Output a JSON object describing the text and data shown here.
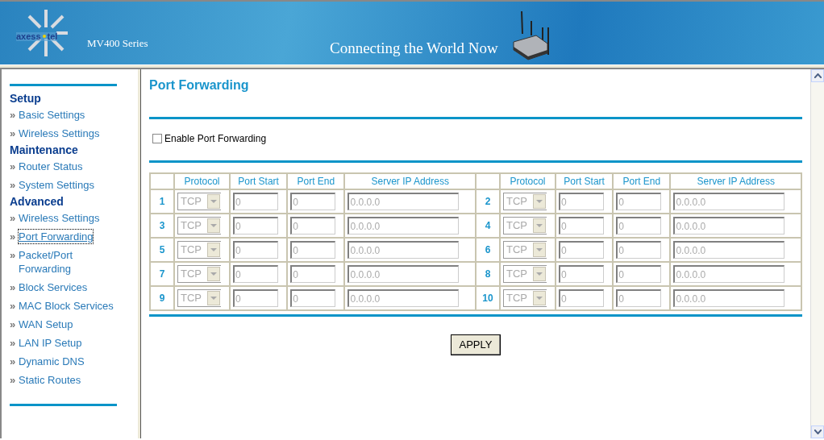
{
  "header": {
    "logo": {
      "left": "axess",
      "right": "tel"
    },
    "model": "MV400 Series",
    "slogan": "Connecting the World Now"
  },
  "sidebar": {
    "bullet": "»",
    "sections": [
      {
        "title": "Setup",
        "items": [
          {
            "label": "Basic Settings",
            "selected": false
          },
          {
            "label": "Wireless Settings",
            "selected": false
          }
        ]
      },
      {
        "title": "Maintenance",
        "items": [
          {
            "label": "Router Status",
            "selected": false
          },
          {
            "label": "System Settings",
            "selected": false
          }
        ]
      },
      {
        "title": "Advanced",
        "items": [
          {
            "label": "Wireless Settings",
            "selected": false
          },
          {
            "label": "Port Forwarding",
            "selected": true
          },
          {
            "label": "Packet/Port Forwarding",
            "selected": false
          },
          {
            "label": "Block Services",
            "selected": false
          },
          {
            "label": "MAC Block Services",
            "selected": false
          },
          {
            "label": "WAN Setup",
            "selected": false
          },
          {
            "label": "LAN IP Setup",
            "selected": false
          },
          {
            "label": "Dynamic DNS",
            "selected": false
          },
          {
            "label": "Static Routes",
            "selected": false
          }
        ]
      }
    ]
  },
  "page": {
    "title": "Port Forwarding",
    "enable": {
      "label": "Enable Port Forwarding",
      "checked": false
    },
    "table": {
      "column_groups": [
        [
          "Protocol",
          "Port Start",
          "Port End",
          "Server IP Address"
        ],
        [
          "Protocol",
          "Port Start",
          "Port End",
          "Server IP Address"
        ]
      ],
      "rules": [
        {
          "number": "1",
          "protocol": "TCP",
          "port_start": "0",
          "port_end": "0",
          "server_ip": "0.0.0.0",
          "disabled": true
        },
        {
          "number": "2",
          "protocol": "TCP",
          "port_start": "0",
          "port_end": "0",
          "server_ip": "0.0.0.0",
          "disabled": true
        },
        {
          "number": "3",
          "protocol": "TCP",
          "port_start": "0",
          "port_end": "0",
          "server_ip": "0.0.0.0",
          "disabled": true
        },
        {
          "number": "4",
          "protocol": "TCP",
          "port_start": "0",
          "port_end": "0",
          "server_ip": "0.0.0.0",
          "disabled": true
        },
        {
          "number": "5",
          "protocol": "TCP",
          "port_start": "0",
          "port_end": "0",
          "server_ip": "0.0.0.0",
          "disabled": true
        },
        {
          "number": "6",
          "protocol": "TCP",
          "port_start": "0",
          "port_end": "0",
          "server_ip": "0.0.0.0",
          "disabled": true
        },
        {
          "number": "7",
          "protocol": "TCP",
          "port_start": "0",
          "port_end": "0",
          "server_ip": "0.0.0.0",
          "disabled": true
        },
        {
          "number": "8",
          "protocol": "TCP",
          "port_start": "0",
          "port_end": "0",
          "server_ip": "0.0.0.0",
          "disabled": true
        },
        {
          "number": "9",
          "protocol": "TCP",
          "port_start": "0",
          "port_end": "0",
          "server_ip": "0.0.0.0",
          "disabled": true
        },
        {
          "number": "10",
          "protocol": "TCP",
          "port_start": "0",
          "port_end": "0",
          "server_ip": "0.0.0.0",
          "disabled": true
        }
      ]
    },
    "apply_button": "APPLY"
  }
}
